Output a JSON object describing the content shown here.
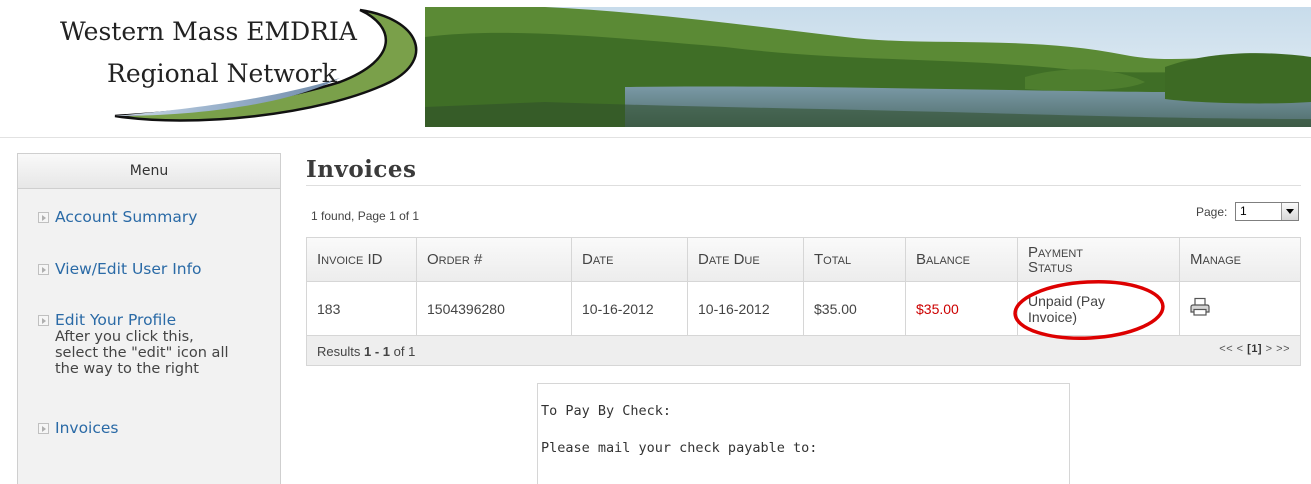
{
  "header": {
    "logo_line1": "Western Mass EMDRIA",
    "logo_line2": "Regional Network"
  },
  "sidebar": {
    "title": "Menu",
    "items": [
      {
        "label": "Account Summary"
      },
      {
        "label": "View/Edit User Info"
      },
      {
        "label": "Edit Your Profile",
        "note_lines": [
          "After you click this,",
          "select the \"edit\" icon all",
          "the way to the right"
        ]
      },
      {
        "label": "Invoices"
      }
    ]
  },
  "main": {
    "title": "Invoices",
    "found_text": "1 found, Page 1 of 1",
    "page_label": "Page:",
    "page_select_value": "1",
    "table": {
      "headers": [
        "Invoice ID",
        "Order #",
        "Date",
        "Date Due",
        "Total",
        "Balance",
        "Payment Status",
        "Manage"
      ],
      "header_payment_line1": "Payment",
      "header_payment_line2": "Status",
      "rows": [
        {
          "invoice_id": "183",
          "order_no": "1504396280",
          "date": "10-16-2012",
          "date_due": "10-16-2012",
          "total": "$35.00",
          "balance": "$35.00",
          "status_line1": "Unpaid (Pay",
          "status_line2": "Invoice)",
          "manage_icon": "print-icon"
        }
      ],
      "results_prefix": "Results",
      "results_range": "1 - 1",
      "results_suffix": "of 1",
      "pager_prev": "<< <",
      "pager_current": "[1]",
      "pager_next": "> >>"
    },
    "check": {
      "heading": "To Pay By Check:",
      "text": "Please mail your check payable to:"
    }
  },
  "colors": {
    "link": "#2a6aa6",
    "balance_due": "#cc0000",
    "annotation_circle": "#dd0000"
  }
}
